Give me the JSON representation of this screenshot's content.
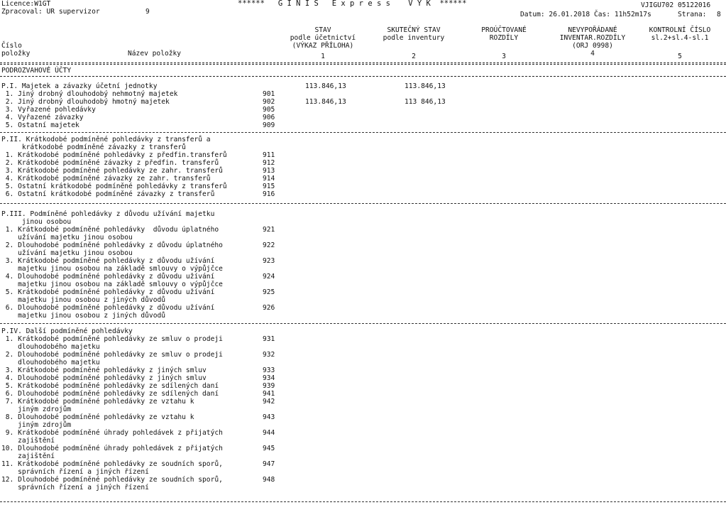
{
  "header": {
    "licence": "Licence:W1GT",
    "zpracoval": "Zpracoval: UR supervizor",
    "zpracoval_num": "9",
    "title": "******   G I N I S   E x p r e s s    V Y K  ******",
    "code": "VJIGU702 05122016",
    "datum": "Datum: 26.01.2018 Čas: 11h52m17s",
    "strana_label": "Strana:",
    "strana": "8"
  },
  "columns": {
    "cislo": "Číslo",
    "polozky": "položky",
    "nazev": "Název položky",
    "stav": [
      "STAV",
      "podle účetnictví",
      "(VÝKAZ PŘÍLOHA)",
      "1"
    ],
    "skutecny": [
      "SKUTEČNÝ STAV",
      "podle inventury",
      "2"
    ],
    "proucto": [
      "PROÚČTOVANÉ",
      "ROZDÍLY",
      "3"
    ],
    "nevyporadane": [
      "NEVYPOŘÁDANÉ",
      "INVENTAR.ROZDÍLY",
      "(ORJ 0998)",
      "4"
    ],
    "kontrolni": [
      "KONTROLNÍ ČÍSLO",
      "sl.2+sl.4-sl.1",
      "5"
    ]
  },
  "section_title": "PODROZVAHOVÉ ÚČTY",
  "sections": [
    {
      "title": "P.I. Majetek a závazky účetní jednotky",
      "v1": "113.846,13",
      "v2": "113.846,13",
      "items": [
        {
          "name": " 1. Jiný drobný dlouhodobý nehmotný majetek",
          "code": "901",
          "v1": "",
          "v2": ""
        },
        {
          "name": " 2. Jiný drobný dlouhodobý hmotný majetek",
          "code": "902",
          "v1": "113.846,13",
          "v2": "113 846,13"
        },
        {
          "name": " 3. Vyřazené pohledávky",
          "code": "905",
          "v1": "",
          "v2": ""
        },
        {
          "name": " 4. Vyřazené závazky",
          "code": "906",
          "v1": "",
          "v2": ""
        },
        {
          "name": " 5. Ostatní majetek",
          "code": "909",
          "v1": "",
          "v2": ""
        }
      ]
    },
    {
      "title": "P.II. Krátkodobé podmíněné pohledávky z transferů a\n     krátkodobé podmíněné závazky z transferů",
      "items": [
        {
          "name": " 1. Krátkodobé podmíněné pohledávky z předfin.transferů",
          "code": "911"
        },
        {
          "name": " 2. Krátkodobé podmíněné závazky z předfin. transferů",
          "code": "912"
        },
        {
          "name": " 3. Krátkodobé podmíněné pohledávky ze zahr. transferů",
          "code": "913"
        },
        {
          "name": " 4. Krátkodobé podmíněné závazky ze zahr. transferů",
          "code": "914"
        },
        {
          "name": " 5. Ostatní krátkodobé podmíněné pohledávky z transferů",
          "code": "915"
        },
        {
          "name": " 6. Ostatní krátkodobé podmíněné závazky z transferů",
          "code": "916"
        }
      ]
    },
    {
      "title": "P.III. Podmíněné pohledávky z důvodu užívání majetku\n     jinou osobou",
      "items": [
        {
          "name": " 1. Krátkodobé podmíněné pohledávky  důvodu úplatného\n    užívání majetku jinou osobou",
          "code": "921"
        },
        {
          "name": " 2. Dlouhodobé podmíněné pohledávky z důvodu úplatného\n    užívání majetku jinou osobou",
          "code": "922"
        },
        {
          "name": " 3. Krátkodobé podmíněné pohledávky z důvodu užívání\n    majetku jinou osobou na základě smlouvy o výpůjčce",
          "code": "923"
        },
        {
          "name": " 4. Dlouhodobé podmíněné pohledávky z důvodu užívání\n    majetku jinou osobou na základě smlouvy o výpůjčce",
          "code": "924"
        },
        {
          "name": " 5. Krátkodobé podmíněné pohledávky z důvodu užívání\n    majetku jinou osobou z jiných důvodů",
          "code": "925"
        },
        {
          "name": " 6. Dlouhodobé podmíněné pohledávky z důvodu užívání\n    majetku jinou osobou z jiných důvodů",
          "code": "926"
        }
      ]
    },
    {
      "title": "P.IV. Další podmíněné pohledávky",
      "items": [
        {
          "name": " 1. Krátkodobé podmíněné pohledávky ze smluv o prodeji\n    dlouhodobého majetku",
          "code": "931"
        },
        {
          "name": " 2. Dlouhodobé podmíněné pohledávky ze smluv o prodeji\n    dlouhodobého majetku",
          "code": "932"
        },
        {
          "name": " 3. Krátkodobé podmíněné pohledávky z jiných smluv",
          "code": "933"
        },
        {
          "name": " 4. Dlouhodobé podmíněné pohledávky z jiných smluv",
          "code": "934"
        },
        {
          "name": " 5. Krátkodobé podmíněné pohledávky ze sdílených daní",
          "code": "939"
        },
        {
          "name": " 6. Dlouhodobé podmíněné pohledávky ze sdílených daní",
          "code": "941"
        },
        {
          "name": " 7. Krátkodobé podmíněné pohledávky ze vztahu k\n    jiným zdrojům",
          "code": "942"
        },
        {
          "name": " 8. Dlouhodobé podmíněné pohledávky ze vztahu k\n    jiným zdrojům",
          "code": "943"
        },
        {
          "name": " 9. Krátkodobé podmíněné úhrady pohledávek z přijatých\n    zajištění",
          "code": "944"
        },
        {
          "name": "10. Dlouhodobé podmíněné úhrady pohledávek z přijatých\n    zajištění",
          "code": "945"
        },
        {
          "name": "11. Krátkodobé podmíněné pohledávky ze soudních sporů,\n    správních řízení a jiných řízení",
          "code": "947"
        },
        {
          "name": "12. Dlouhodobé podmíněné pohledávky ze soudních sporů,\n    správních řízení a jiných řízení",
          "code": "948"
        }
      ]
    }
  ]
}
